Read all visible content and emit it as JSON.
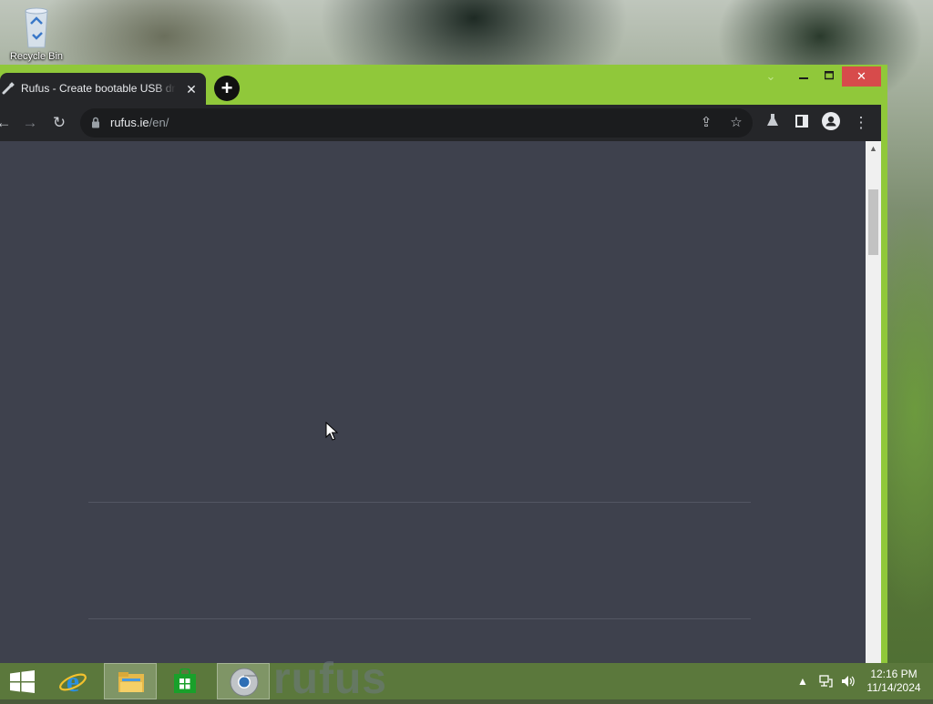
{
  "desktop": {
    "recycle_bin_label": "Recycle Bin"
  },
  "browser": {
    "tab": {
      "title": "Rufus - Create bootable USB drives the easy way",
      "favicon": "rufus-usb-icon",
      "close_icon": "close-icon"
    },
    "new_tab_icon": "plus-icon",
    "window_controls": {
      "dropdown": "chevron-down-icon",
      "minimize": "minimize-icon",
      "maximize": "maximize-icon",
      "close": "close-icon"
    },
    "nav": {
      "back_icon": "back-arrow-icon",
      "forward_icon": "forward-arrow-icon",
      "reload_icon": "reload-icon"
    },
    "address": {
      "host": "rufus.ie",
      "path": "/en/"
    },
    "omnibox_icons": [
      "share-icon",
      "bookmark-star-icon"
    ],
    "toolbar_icons": [
      "labs-flask-icon",
      "side-panel-icon",
      "profile-icon",
      "kebab-menu-icon"
    ],
    "page_bg": "#3e414d",
    "frame_color": "#90c83a"
  },
  "taskbar": {
    "apps": [
      "windows-start-icon",
      "internet-explorer-icon",
      "file-explorer-icon",
      "windows-store-icon",
      "chrome-icon"
    ],
    "watermark": "rufus",
    "tray_icons": [
      "show-hidden-icons-chevron",
      "network-icon",
      "volume-icon"
    ],
    "time": "12:16 PM",
    "date": "11/14/2024"
  }
}
